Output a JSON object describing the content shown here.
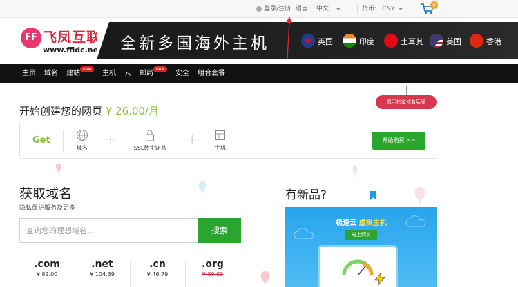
{
  "topbar": {
    "login_link": "登录/注册",
    "language_label": "语言:",
    "language_value": "中文",
    "currency_label": "货币:",
    "currency_value": "CNY",
    "cart_count": "0"
  },
  "logo": {
    "mark": "FF",
    "name": "飞凤互联",
    "url": "www.ffidc.net"
  },
  "banner": {
    "title": "全新多国海外主机",
    "locations": [
      {
        "label": "英国",
        "color": "#1b3f8f"
      },
      {
        "label": "印度",
        "color": "#ef8a2e"
      },
      {
        "label": "土耳其",
        "color": "#e30a17"
      },
      {
        "label": "美国",
        "color": "#3c5aa8"
      },
      {
        "label": "香港",
        "color": "#de2910"
      }
    ]
  },
  "nav": {
    "items": [
      {
        "label": "主页"
      },
      {
        "label": "域名"
      },
      {
        "label": "建站",
        "badge": "new"
      },
      {
        "label": "主机"
      },
      {
        "label": "云"
      },
      {
        "label": "邮局",
        "badge": "new"
      },
      {
        "label": "安全"
      },
      {
        "label": "组合套餐"
      }
    ]
  },
  "tag": {
    "label": "显示指定域名后缀"
  },
  "build": {
    "heading_text": "开始创建您的网页",
    "price": "¥ 26.00/月",
    "get_label": "Get",
    "services": [
      {
        "label": "域名",
        "icon": "globe-www-icon"
      },
      {
        "label": "SSL数字证书",
        "icon": "padlock-icon"
      },
      {
        "label": "主机",
        "icon": "server-icon"
      }
    ],
    "buy_button": "开始购买 >>"
  },
  "domain": {
    "heading": "获取域名",
    "subheading": "隐私保护服务及更多",
    "search_placeholder": "查询您的理想域名...",
    "search_button": "搜索",
    "tlds": [
      {
        "name": ".com",
        "price": "¥ 82.00"
      },
      {
        "name": ".net",
        "price": "¥ 104.39"
      },
      {
        "name": ".cn",
        "price": "¥ 46.79"
      },
      {
        "name": ".org",
        "price": "¥ 89.99",
        "strike": true
      }
    ]
  },
  "new_products": {
    "heading": "有新品?",
    "promo_title_prefix": "极速云",
    "promo_title_accent": "虚拟主机",
    "promo_button": "马上购买"
  },
  "colors": {
    "brand_red": "#d9263b",
    "accent_green": "#2aa52e",
    "price_green": "#8ac13b",
    "nav_bg": "#111111",
    "promo_blue": "#27a4ee"
  }
}
